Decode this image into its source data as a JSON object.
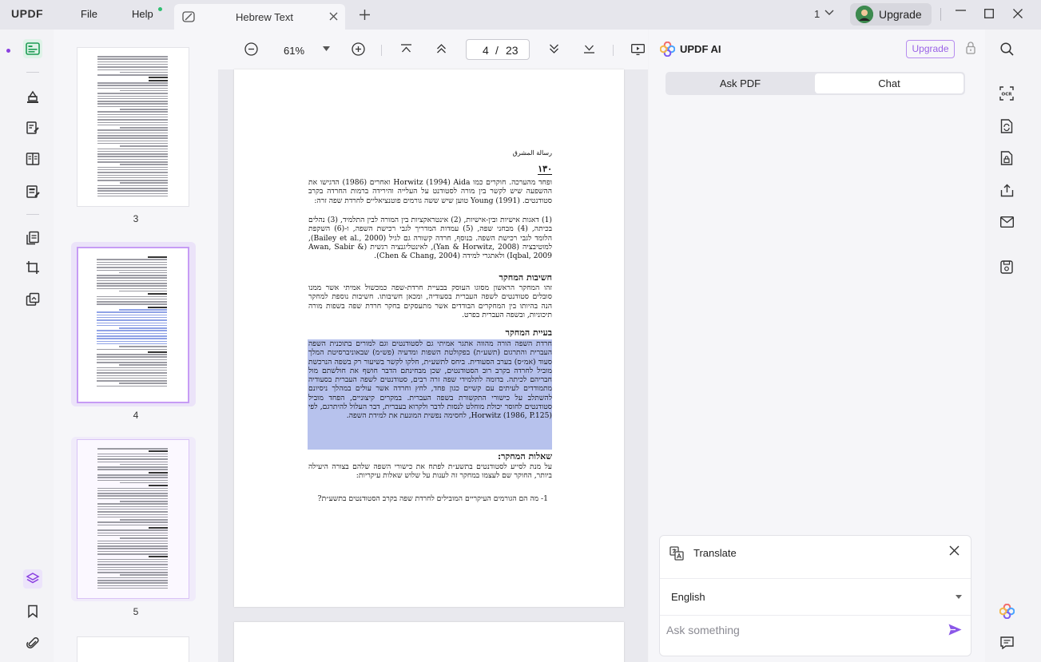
{
  "app": {
    "logo": "UPDF",
    "menu": {
      "file": "File",
      "help": "Help"
    },
    "tab_title": "Hebrew Text",
    "window_count": "1",
    "upgrade_label": "Upgrade"
  },
  "thumbnails": [
    {
      "label": "3"
    },
    {
      "label": "4"
    },
    {
      "label": "5"
    }
  ],
  "toolbar": {
    "zoom": "61%",
    "page_current": "4",
    "page_sep": "/",
    "page_total": "23"
  },
  "document": {
    "header_small": "رسالة المشرق",
    "page_number": "١٣٠",
    "para1": "ופחד מהערכה. חוקרים כמו Horwitz (1994) Aida ואחרים (1986) הדגישו את ההשפעה שיש לקשר בין מורה לסטודנט על העלייה והירידה ברמות החרדה בקרב סטודנטים. Young (1991) טוען שיש ששה גורמים פוטנציאליים לחרדת שפה זרה:",
    "para2": "(1) דאגות אישיות ובין-אישיות, (2) אינטראקציות בין המורה לבין התלמיד, (3) נהלים בכיתה, (4) מבחני שפה, (5) עמדות המדריך לגבי רכישת השפה, ו-(6) השקפת הלומד לגבי רכישת השפה. בנוסף, חרדה קשורה גם לגיל (Bailey et al., 2000), למוטיבציה (Yan & Horwitz, 2008), לאינטליגנציה רגשית (Awan, Sabir & Iqbal, 2009) ולאתגרי למידה (Chen & Chang, 2004).",
    "heading1": "חשיבות המחקר",
    "para3": "זהו המחקר הראשון מסוגו העוסק בבעיית חרדת-שפה כמכשול אמיתי אשר ממנו סובלים סטודנטים לשפה העברית בסעודיה, ומכאן חשיבותו. חשיבות נוספת למחקר הנה בהיותו בין המחקרים הבודדים אשר מתעסקים בחקר חרדת שפה בשפות מורה תיכוניות, ובשפה העברית בפרט.",
    "heading2": "בעיית המחקר",
    "para4": "חרדת השפה הורה מהווה אתגר אמיתי גם לסטודנטים וגם למורים בתוכנית השפה העברית והתרגום (תשע״ת) בפקולטת השפות ומדעיה (פש״מ) שבאוניברסיטת המלך סעוד (אמ״ס) בערב הסעודית. ביחס לתשע״ת, חלקו לקשר בשיעור רק בשפה הנרכשת מוביל לחרדה בקרב רוב הסטודנטים, שכן מבחינתם הדבר חושף את חולשתם מול חבריהם לכיתה. בדומה לתלמידי שפה זרה רבים, סטודנטים לשפה העברית בסעודיה מתמודדים לעיתים עם קשיים כגון פחד, לחץ וחרדה אשר עולים במהלך ניסיונם להשתלב על כישורי התקשורת בשפה העברית. במקרים קיצוניים, הפחד מוביל סטודנטים לחוסר יכולת מוחלט לנסות לדבר ולקרוא בעברית, דבר העלול להיתרגם, לפי Horwitz (1986, P.125), לחסימה נפשית המונעת את למידת השפה.",
    "heading3": "שאלות המחקר:",
    "para5": "על מנת לסייע לסטודנטים בתשע״ת לפתח את כישורי השפה שלהם בצורה היעילה ביותר, החוקר שם לעצמו במחקר זה לענות על שלוש שאלות עיקריות:",
    "para6": "1- מה הם הגורמים העיקריים המובילים לחרדת שפה בקרב הסטודנטים בתשע״ת?"
  },
  "ai_panel": {
    "title": "UPDF AI",
    "upgrade_label": "Upgrade",
    "tabs": [
      {
        "label": "Ask PDF"
      },
      {
        "label": "Chat"
      }
    ],
    "translate": {
      "title": "Translate",
      "language": "English",
      "placeholder": "Ask something"
    }
  },
  "colors": {
    "accent_purple": "#9a62e6",
    "highlight": "#aab7ea",
    "brand_red": "#e8463a",
    "reader_green": "#1f9d55"
  }
}
